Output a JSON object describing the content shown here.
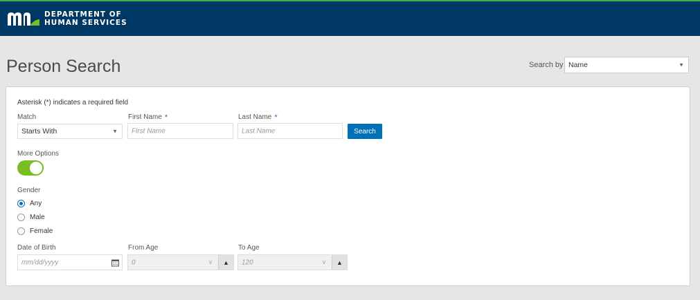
{
  "header": {
    "brand_line1": "DEPARTMENT OF",
    "brand_line2": "HUMAN SERVICES",
    "bar_color": "#003865",
    "accent_color": "#3fae49"
  },
  "page": {
    "title": "Person Search",
    "search_by_label": "Search by",
    "search_by_value": "Name"
  },
  "form": {
    "required_note": "Asterisk (*) indicates a required field",
    "match_label": "Match",
    "match_value": "Starts With",
    "first_name_label": "First Name",
    "first_name_placeholder": "First Name",
    "last_name_label": "Last Name",
    "last_name_placeholder": "Last Name",
    "required_marker": "*",
    "search_button": "Search",
    "more_options_label": "More Options",
    "more_options_on": true,
    "gender_label": "Gender",
    "gender_options": [
      "Any",
      "Male",
      "Female"
    ],
    "gender_selected": "Any",
    "dob_label": "Date of Birth",
    "dob_placeholder": "mm/dd/yyyy",
    "from_age_label": "From Age",
    "from_age_placeholder": "0",
    "to_age_label": "To Age",
    "to_age_placeholder": "120"
  }
}
